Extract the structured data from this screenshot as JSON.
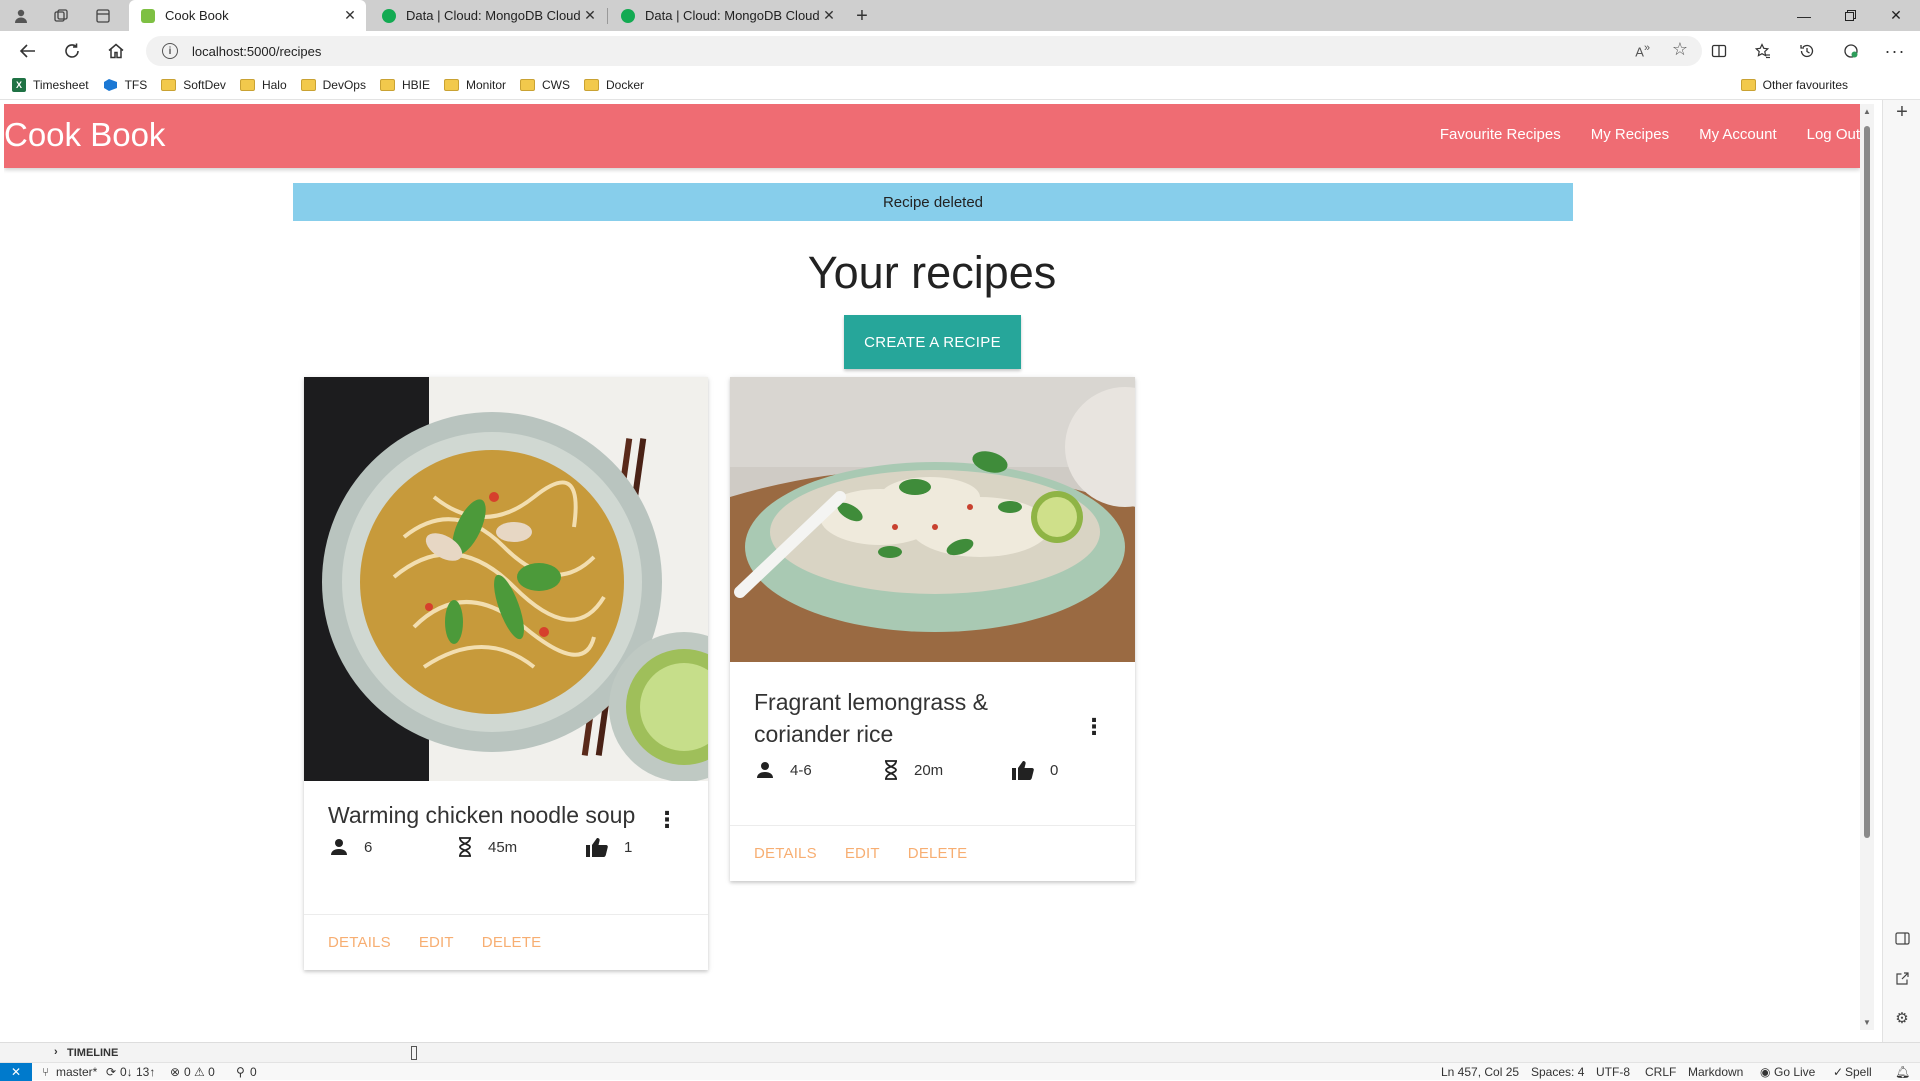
{
  "browser": {
    "tabs": [
      {
        "title": "Cook Book",
        "active": true,
        "favicon_color": "#7ec043"
      },
      {
        "title": "Data | Cloud: MongoDB Cloud",
        "active": false,
        "favicon_color": "#13aa52"
      },
      {
        "title": "Data | Cloud: MongoDB Cloud",
        "active": false,
        "favicon_color": "#13aa52"
      }
    ],
    "new_tab_symbol": "+",
    "url": "localhost:5000/recipes",
    "bookmarks": [
      {
        "label": "Timesheet",
        "icon": "excel-icon"
      },
      {
        "label": "TFS",
        "icon": "tfs-icon"
      },
      {
        "label": "SoftDev",
        "icon": "folder-icon"
      },
      {
        "label": "Halo",
        "icon": "folder-icon"
      },
      {
        "label": "DevOps",
        "icon": "folder-icon"
      },
      {
        "label": "HBIE",
        "icon": "folder-icon"
      },
      {
        "label": "Monitor",
        "icon": "folder-icon"
      },
      {
        "label": "CWS",
        "icon": "folder-icon"
      },
      {
        "label": "Docker",
        "icon": "folder-icon"
      }
    ],
    "other_favourites": "Other favourites"
  },
  "app": {
    "brand": "Cook Book",
    "nav": [
      "Favourite Recipes",
      "My Recipes",
      "My Account",
      "Log Out"
    ],
    "flash": "Recipe deleted",
    "page_title": "Your recipes",
    "create_button": "CREATE A RECIPE",
    "accent_color": "#ef6c73",
    "button_color": "#26a69a",
    "action_color": "#f7ae72",
    "flash_color": "#87ceeb"
  },
  "recipes": [
    {
      "title": "Warming chicken noodle soup",
      "serves": "6",
      "time": "45m",
      "likes": "1",
      "actions": [
        "DETAILS",
        "EDIT",
        "DELETE"
      ]
    },
    {
      "title": "Fragrant lemongrass & coriander rice",
      "serves": "4-6",
      "time": "20m",
      "likes": "0",
      "actions": [
        "DETAILS",
        "EDIT",
        "DELETE"
      ]
    }
  ],
  "vscode": {
    "timeline": "TIMELINE",
    "branch": "master*",
    "sync": "0↓ 13↑",
    "problems": "0 ⚠ 0",
    "ports": "0",
    "position": "Ln 457, Col 25",
    "spaces": "Spaces: 4",
    "encoding": "UTF-8",
    "eol": "CRLF",
    "language": "Markdown",
    "go_live": "Go Live",
    "spell": "Spell"
  }
}
